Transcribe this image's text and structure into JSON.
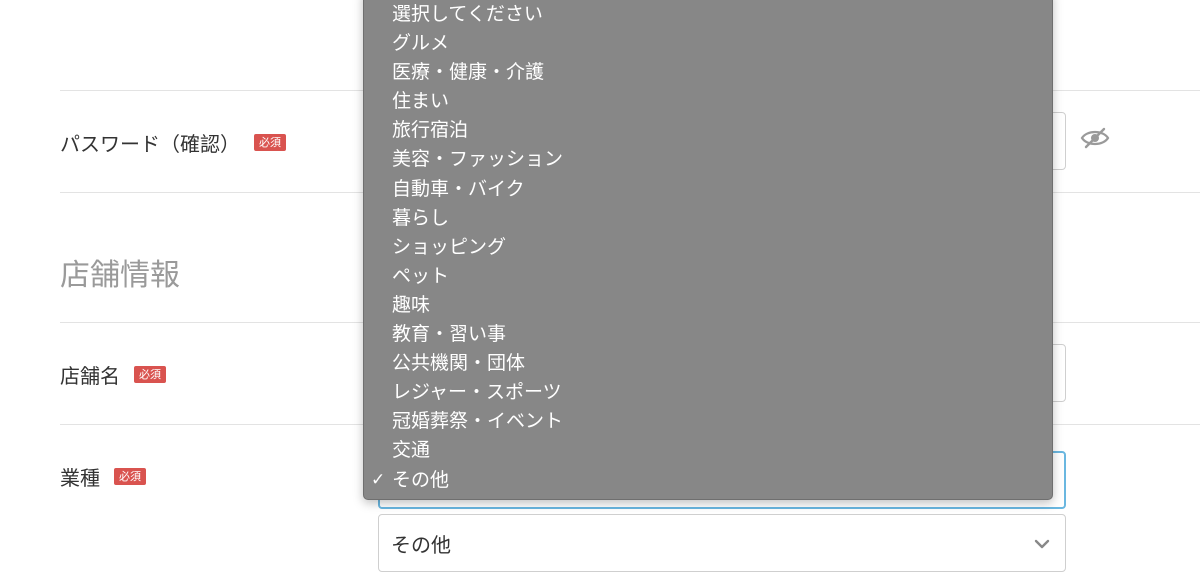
{
  "form": {
    "password_confirm": {
      "label": "パスワード（確認）",
      "required_badge": "必須"
    },
    "section_store_info": {
      "heading": "店舗情報"
    },
    "store_name": {
      "label": "店舗名",
      "required_badge": "必須"
    },
    "industry": {
      "label": "業種",
      "required_badge": "必須",
      "selected_value": "その他"
    }
  },
  "dropdown": {
    "options": [
      "選択してください",
      "グルメ",
      "医療・健康・介護",
      "住まい",
      "旅行宿泊",
      "美容・ファッション",
      "自動車・バイク",
      "暮らし",
      "ショッピング",
      "ペット",
      "趣味",
      "教育・習い事",
      "公共機関・団体",
      "レジャー・スポーツ",
      "冠婚葬祭・イベント",
      "交通",
      "その他"
    ],
    "selected_index": 16,
    "check_mark": "✓"
  },
  "icons": {
    "password_visibility": "eye-slash-icon",
    "select_chevron": "chevron-down-icon"
  },
  "colors": {
    "required_badge": "#d9534f",
    "focus_border": "#6ab7e0",
    "dropdown_background": "#878787",
    "section_heading": "#9a9a9a"
  }
}
